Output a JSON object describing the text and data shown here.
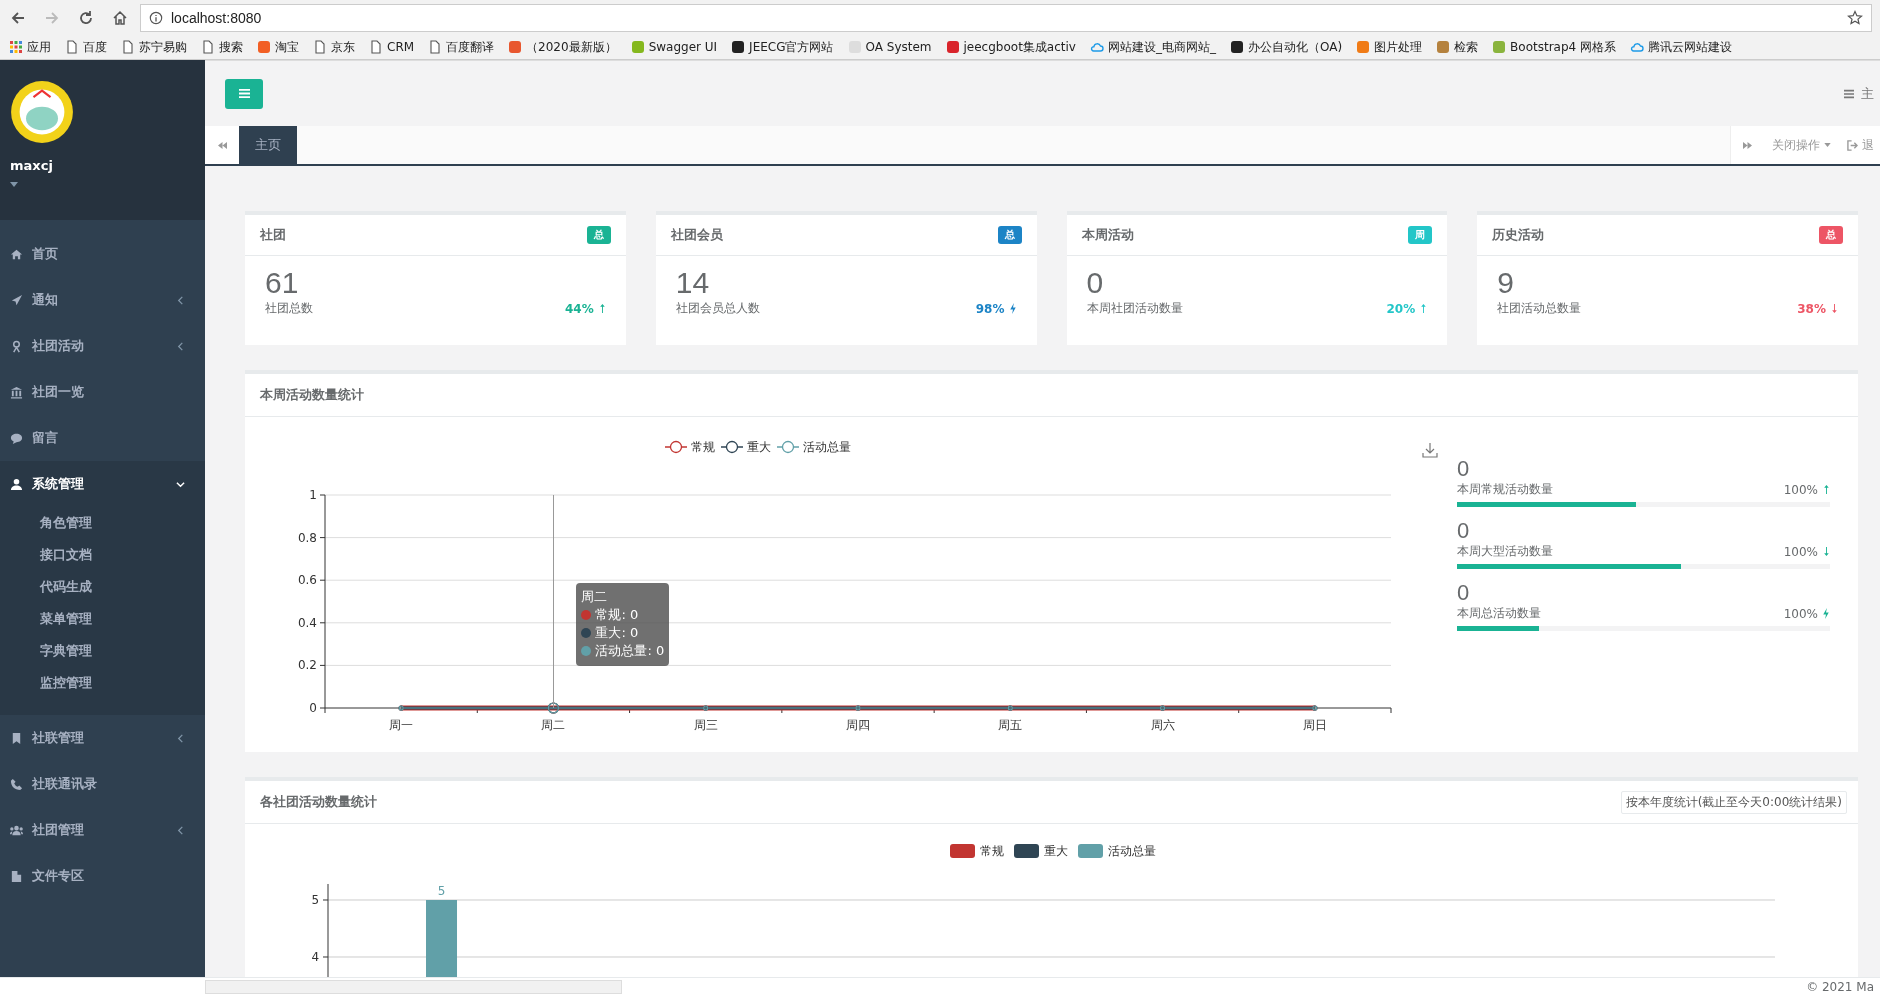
{
  "browser": {
    "url": "localhost:8080",
    "bookmarks": [
      {
        "label": "应用",
        "kind": "apps"
      },
      {
        "label": "百度",
        "kind": "page"
      },
      {
        "label": "苏宁易购",
        "kind": "page"
      },
      {
        "label": "搜索",
        "kind": "page"
      },
      {
        "label": "淘宝",
        "kind": "site",
        "color": "#f25f24"
      },
      {
        "label": "京东",
        "kind": "page"
      },
      {
        "label": "CRM",
        "kind": "page"
      },
      {
        "label": "百度翻译",
        "kind": "page"
      },
      {
        "label": "（2020最新版）",
        "kind": "site",
        "color": "#e8572f"
      },
      {
        "label": "Swagger UI",
        "kind": "site",
        "color": "#85b81e"
      },
      {
        "label": "JEECG官方网站",
        "kind": "site",
        "color": "#222222"
      },
      {
        "label": "OA System",
        "kind": "site",
        "color": "#dddddd"
      },
      {
        "label": "jeecgboot集成activ",
        "kind": "site",
        "color": "#d9242b"
      },
      {
        "label": "网站建设_电商网站_",
        "kind": "cloud"
      },
      {
        "label": "办公自动化（OA)",
        "kind": "site",
        "color": "#222222"
      },
      {
        "label": "图片处理",
        "kind": "site",
        "color": "#f07b16"
      },
      {
        "label": "检索",
        "kind": "site",
        "color": "#b5823e"
      },
      {
        "label": "Bootstrap4 网格系",
        "kind": "site",
        "color": "#8ab43d"
      },
      {
        "label": "腾讯云网站建设",
        "kind": "cloud"
      }
    ]
  },
  "sidebar": {
    "user": "maxcj",
    "items": [
      {
        "label": "首页"
      },
      {
        "label": "通知",
        "expanded": false
      },
      {
        "label": "社团活动",
        "expanded": false
      },
      {
        "label": "社团一览"
      },
      {
        "label": "留言"
      },
      {
        "label": "系统管理",
        "expanded": true,
        "children": [
          {
            "label": "角色管理"
          },
          {
            "label": "接口文档"
          },
          {
            "label": "代码生成"
          },
          {
            "label": "菜单管理"
          },
          {
            "label": "字典管理"
          },
          {
            "label": "监控管理"
          }
        ]
      },
      {
        "label": "社联管理",
        "expanded": false
      },
      {
        "label": "社联通讯录"
      },
      {
        "label": "社团管理",
        "expanded": false
      },
      {
        "label": "文件专区"
      }
    ]
  },
  "header": {
    "theme": "主"
  },
  "tabs": [
    {
      "label": "主页",
      "selected": true
    }
  ],
  "tab_actions": {
    "close": "关闭操作",
    "logout": "退"
  },
  "cards": [
    {
      "title": "社团",
      "badge": "总",
      "color": "#1ab394",
      "value": "61",
      "desc": "社团总数",
      "percent": "44%",
      "kind": "up"
    },
    {
      "title": "社团会员",
      "badge": "总",
      "color": "#1c84c6",
      "value": "14",
      "desc": "社团会员总人数",
      "percent": "98%",
      "kind": "bolt"
    },
    {
      "title": "本周活动",
      "badge": "周",
      "color": "#23c6c8",
      "value": "0",
      "desc": "本周社团活动数量",
      "percent": "20%",
      "kind": "up"
    },
    {
      "title": "历史活动",
      "badge": "总",
      "color": "#ed5565",
      "value": "9",
      "desc": "社团活动总数量",
      "percent": "38%",
      "kind": "down"
    }
  ],
  "week_panel": {
    "title": "本周活动数量统计",
    "chart_data": {
      "type": "line",
      "categories": [
        "周一",
        "周二",
        "周三",
        "周四",
        "周五",
        "周六",
        "周日"
      ],
      "ylim": [
        0,
        1
      ],
      "yticks": [
        0,
        0.2,
        0.4,
        0.6,
        0.8,
        1
      ],
      "grid": true,
      "legend": true,
      "series": [
        {
          "name": "常规",
          "color": "#c23531",
          "marker": "circle",
          "values": [
            0,
            0,
            0,
            0,
            0,
            0,
            0
          ]
        },
        {
          "name": "重大",
          "color": "#2f4554",
          "marker": "circle",
          "values": [
            0,
            0,
            0,
            0,
            0,
            0,
            0
          ]
        },
        {
          "name": "活动总量",
          "color": "#61a0a8",
          "marker": "circle",
          "values": [
            0,
            0,
            0,
            0,
            0,
            0,
            0
          ]
        }
      ]
    },
    "tooltip": {
      "title": "周二",
      "rows": [
        {
          "label": "常规: 0",
          "color": "#c23531"
        },
        {
          "label": "重大: 0",
          "color": "#2f4554"
        },
        {
          "label": "活动总量: 0",
          "color": "#61a0a8"
        }
      ]
    },
    "stats": [
      {
        "value": "0",
        "label": "本周常规活动数量",
        "percent": "100%",
        "kind": "up",
        "level": 0.48
      },
      {
        "value": "0",
        "label": "本周大型活动数量",
        "percent": "100%",
        "kind": "down",
        "level": 0.6
      },
      {
        "value": "0",
        "label": "本周总活动数量",
        "percent": "100%",
        "kind": "bolt",
        "level": 0.22
      }
    ]
  },
  "club_panel": {
    "title": "各社团活动数量统计",
    "button": "按本年度统计(截止至今天0:00统计结果)",
    "chart_data": {
      "type": "bar",
      "ylim": [
        3.6,
        5
      ],
      "yticks": [
        4,
        5
      ],
      "data_labels": true,
      "legend": true,
      "series": [
        {
          "name": "常规",
          "color": "#c23531",
          "values": [
            null
          ]
        },
        {
          "name": "重大",
          "color": "#2f4554",
          "values": [
            null
          ]
        },
        {
          "name": "活动总量",
          "color": "#61a0a8",
          "values": [
            5
          ]
        }
      ]
    }
  },
  "footer": "© 2021 Ma"
}
